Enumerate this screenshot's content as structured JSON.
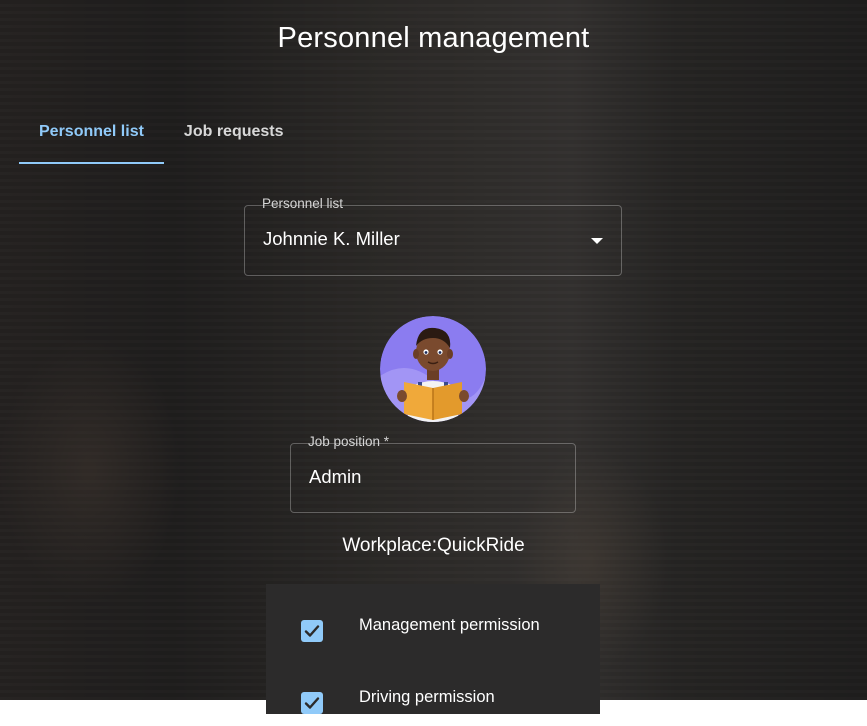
{
  "page": {
    "title": "Personnel management"
  },
  "tabs": [
    {
      "label": "Personnel list",
      "active": true
    },
    {
      "label": "Job requests",
      "active": false
    }
  ],
  "personnel_select": {
    "label": "Personnel list",
    "value": "Johnnie K. Miller"
  },
  "avatar": {
    "icon": "avatar-reading-boy-icon"
  },
  "job_position": {
    "label": "Job position *",
    "value": "Admin"
  },
  "workplace": {
    "text": "Workplace:QuickRide"
  },
  "permissions": [
    {
      "label": "Management permission",
      "checked": true
    },
    {
      "label": "Driving permission",
      "checked": true
    }
  ],
  "colors": {
    "accent": "#90caf9",
    "panel": "#2c2b2b"
  }
}
